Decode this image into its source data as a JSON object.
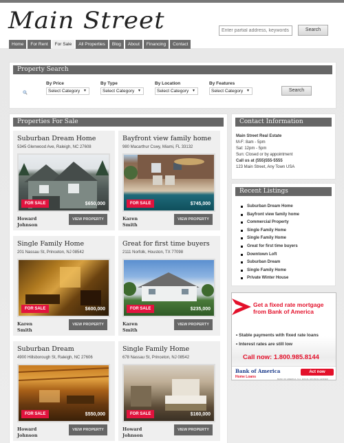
{
  "site": {
    "logo": "Main Street"
  },
  "top_search": {
    "placeholder": "Enter partial address, keywords",
    "button": "Search"
  },
  "nav": {
    "items": [
      {
        "label": "Home",
        "active": false
      },
      {
        "label": "For Rent",
        "active": false
      },
      {
        "label": "For Sale",
        "active": true
      },
      {
        "label": "All Properties",
        "active": false
      },
      {
        "label": "Blog",
        "active": false
      },
      {
        "label": "About",
        "active": false
      },
      {
        "label": "Financing",
        "active": false
      },
      {
        "label": "Contact",
        "active": false
      }
    ]
  },
  "property_search": {
    "title": "Property Search",
    "icon": "magnifier-icon",
    "filters": [
      {
        "label": "By Price",
        "value": "Select Category"
      },
      {
        "label": "By Type",
        "value": "Select Category"
      },
      {
        "label": "By Location",
        "value": "Select Category"
      },
      {
        "label": "By Features",
        "value": "Select Category"
      }
    ],
    "button": "Search"
  },
  "listings": {
    "title": "Properties For Sale",
    "view_label": "VIEW PROPERTY",
    "badge": "FOR SALE",
    "items": [
      {
        "title": "Suburban Dream Home",
        "address": "5345 Glenwood Ave, Raleigh, NC 27608",
        "price": "$650,000",
        "agent_first": "Howard",
        "agent_last": "Johnson",
        "photo": "suburban-house"
      },
      {
        "title": "Bayfront view family home",
        "address": "980 Macarthur Cswy, Miami, FL 33132",
        "price": "$745,000",
        "agent_first": "Karen",
        "agent_last": "Smith",
        "photo": "pool-patio"
      },
      {
        "title": "Single Family Home",
        "address": "201 Nassau St, Princeton, NJ 08542",
        "price": "$600,000",
        "agent_first": "Karen",
        "agent_last": "Smith",
        "photo": "living-room"
      },
      {
        "title": "Great for first time buyers",
        "address": "2111 Norfolk, Houston, TX 77098",
        "price": "$235,000",
        "agent_first": "Karen",
        "agent_last": "Smith",
        "photo": "white-house"
      },
      {
        "title": "Suburban Dream",
        "address": "4900 Hillsborough St, Raleigh, NC 27606",
        "price": "$550,000",
        "agent_first": "Howard",
        "agent_last": "Johnson",
        "photo": "wood-interior"
      },
      {
        "title": "Single Family Home",
        "address": "678 Nassau St, Princeton, NJ 08542",
        "price": "$160,000",
        "agent_first": "Howard",
        "agent_last": "Johnson",
        "photo": "bedroom"
      }
    ]
  },
  "contact": {
    "title": "Contact Information",
    "company": "Main Street Real Estate",
    "hours": [
      "M-F: 8am - 5pm",
      "Sat: 12pm - 5pm",
      "Sun: Closed or by appointment"
    ],
    "phone": "Call us at (555)555-5555",
    "address": "123 Main Street, Any Town USA"
  },
  "recent": {
    "title": "Recent Listings",
    "items": [
      "Suburban Dream Home",
      "Bayfront view family home",
      "Commercial Property",
      "Single Family Home",
      "Single Family Home",
      "Great for first time buyers",
      "Downtown Loft",
      "Suburban Dream",
      "Single Family Home",
      "Private Winter House"
    ]
  },
  "ad": {
    "headline": "Get a fixed rate mortgage from Bank of America",
    "bullets": [
      "• Stable payments with fixed rate loans",
      "• Interest rates are still low"
    ],
    "call": "Call now: 1.800.985.8144",
    "brand": "Bank of America",
    "sub_brand": "Home Loans",
    "cta": "Act now",
    "legal": "BANK OF AMERICA, N.A. EQUAL HOUSING LENDER",
    "accent": "#e3102a",
    "brand_color": "#1a3a8a"
  },
  "colors": {
    "panel_header": "#666666",
    "badge": "#e2133e",
    "nav": "#6a6a6a"
  }
}
